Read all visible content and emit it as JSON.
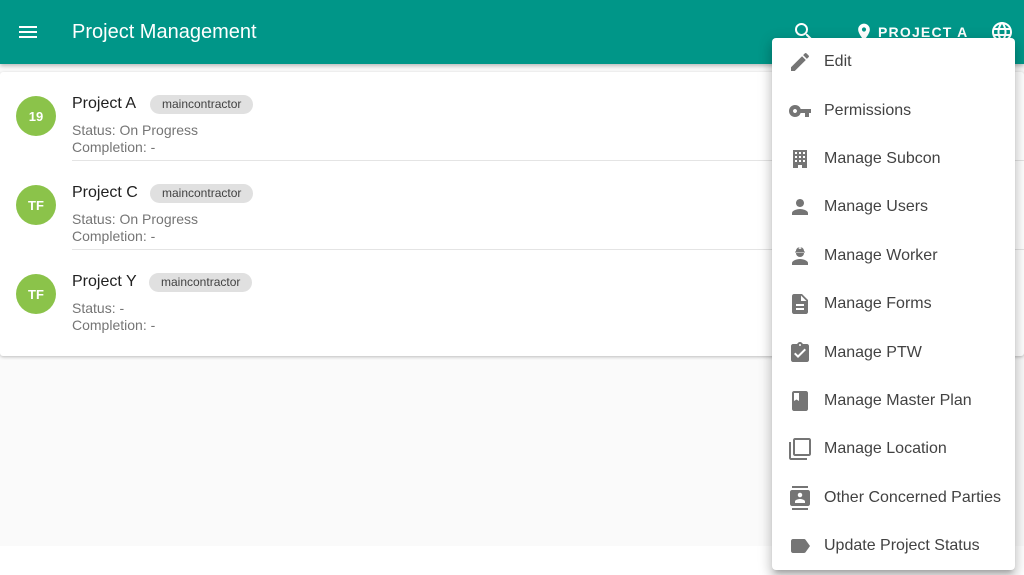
{
  "appbar": {
    "title": "Project Management",
    "menu_icon": "hamburger-menu-icon",
    "search_icon": "search-icon",
    "current_project_label": "PROJECT A",
    "location_icon": "map-pin-icon",
    "language_icon": "globe-icon"
  },
  "colors": {
    "primary": "#009688",
    "avatar": "#8bc34a",
    "chip_bg": "#e0e0e0",
    "icon_gray": "#757575"
  },
  "projects": [
    {
      "avatar": "19",
      "name": "Project A",
      "role": "maincontractor",
      "status": "Status: On Progress",
      "completion": "Completion: -"
    },
    {
      "avatar": "TF",
      "name": "Project C",
      "role": "maincontractor",
      "status": "Status: On Progress",
      "completion": "Completion: -"
    },
    {
      "avatar": "TF",
      "name": "Project Y",
      "role": "maincontractor",
      "status": "Status: -",
      "completion": "Completion: -"
    }
  ],
  "menu": {
    "items": [
      {
        "label": "Edit",
        "icon": "pencil-icon"
      },
      {
        "label": "Permissions",
        "icon": "key-icon"
      },
      {
        "label": "Manage Subcon",
        "icon": "building-icon"
      },
      {
        "label": "Manage Users",
        "icon": "person-icon"
      },
      {
        "label": "Manage Worker",
        "icon": "engineer-icon"
      },
      {
        "label": "Manage Forms",
        "icon": "document-icon"
      },
      {
        "label": "Manage PTW",
        "icon": "clipboard-check-icon"
      },
      {
        "label": "Manage Master Plan",
        "icon": "book-icon"
      },
      {
        "label": "Manage Location",
        "icon": "layers-icon"
      },
      {
        "label": "Other Concerned Parties",
        "icon": "contacts-icon"
      },
      {
        "label": "Update Project Status",
        "icon": "label-tag-icon"
      }
    ]
  }
}
